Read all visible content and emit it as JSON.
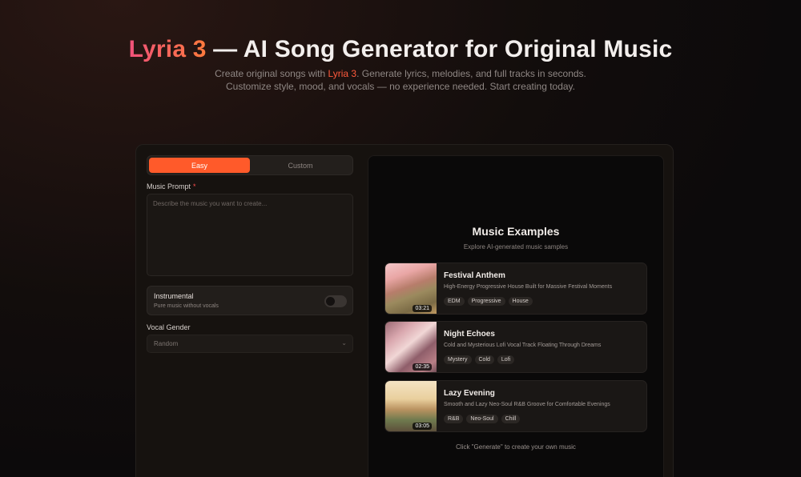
{
  "hero": {
    "brand": "Lyria 3",
    "title_rest": " — AI Song Generator for Original Music",
    "sub1_pre": "Create original songs with ",
    "sub1_brand": "Lyria 3",
    "sub1_post": ". Generate lyrics, melodies, and full tracks in seconds.",
    "sub2": "Customize style, mood, and vocals — no experience needed. Start creating today."
  },
  "form": {
    "tabs": [
      {
        "label": "Easy",
        "active": true
      },
      {
        "label": "Custom",
        "active": false
      }
    ],
    "prompt_label": "Music Prompt",
    "prompt_required": "*",
    "prompt_placeholder": "Describe the music you want to create...",
    "instrumental": {
      "title": "Instrumental",
      "subtitle": "Pure music without vocals",
      "on": false
    },
    "vocal_gender": {
      "label": "Vocal Gender",
      "value": "Random"
    }
  },
  "examples": {
    "title": "Music Examples",
    "subtitle": "Explore AI-generated music samples",
    "songs": [
      {
        "name": "Festival Anthem",
        "desc": "High-Energy Progressive House Built for Massive Festival Moments",
        "duration": "03:21",
        "tags": [
          "EDM",
          "Progressive",
          "House"
        ]
      },
      {
        "name": "Night Echoes",
        "desc": "Cold and Mysterious Lofi Vocal Track Floating Through Dreams",
        "duration": "02:35",
        "tags": [
          "Mystery",
          "Cold",
          "Lofi"
        ]
      },
      {
        "name": "Lazy Evening",
        "desc": "Smooth and Lazy Neo-Soul R&B Groove for Comfortable Evenings",
        "duration": "03:05",
        "tags": [
          "R&B",
          "Neo-Soul",
          "Chill"
        ]
      }
    ],
    "hint": "Click \"Generate\" to create your own music"
  },
  "colors": {
    "accent": "#ff5a2a",
    "brand_gradient_start": "#f0527a",
    "brand_gradient_end": "#ff7a3c"
  }
}
